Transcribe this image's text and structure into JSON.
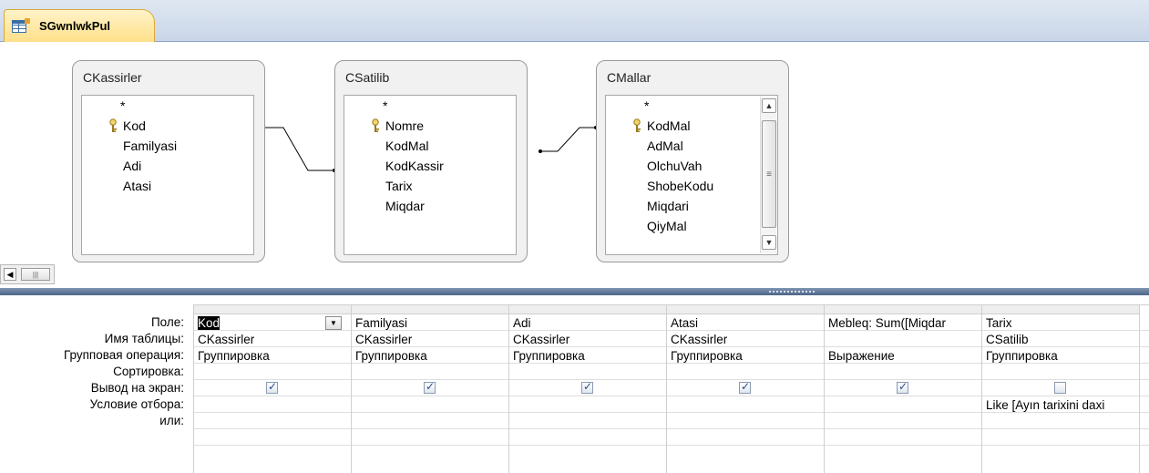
{
  "tab": {
    "title": "SGwnlwkPul",
    "icon": "query-design-icon"
  },
  "tables": [
    {
      "name": "CKassirler",
      "fields": [
        "*",
        "Kod",
        "Familyasi",
        "Adi",
        "Atasi"
      ],
      "key_field": "Kod"
    },
    {
      "name": "CSatilib",
      "fields": [
        "*",
        "Nomre",
        "KodMal",
        "KodKassir",
        "Tarix",
        "Miqdar"
      ],
      "key_field": "Nomre"
    },
    {
      "name": "CMallar",
      "fields": [
        "*",
        "KodMal",
        "AdMal",
        "OlchuVah",
        "ShobeKodu",
        "Miqdari",
        "QiyMal"
      ],
      "key_field": "KodMal"
    }
  ],
  "row_labels": {
    "field": "Поле:",
    "table": "Имя таблицы:",
    "total": "Групповая операция:",
    "sort": "Сортировка:",
    "show": "Вывод на экран:",
    "criteria": "Условие отбора:",
    "or": "или:"
  },
  "columns": [
    {
      "field": "Kod",
      "table": "CKassirler",
      "total": "Группировка",
      "sort": "",
      "show": true,
      "criteria": "",
      "or": ""
    },
    {
      "field": "Familyasi",
      "table": "CKassirler",
      "total": "Группировка",
      "sort": "",
      "show": true,
      "criteria": "",
      "or": ""
    },
    {
      "field": "Adi",
      "table": "CKassirler",
      "total": "Группировка",
      "sort": "",
      "show": true,
      "criteria": "",
      "or": ""
    },
    {
      "field": "Atasi",
      "table": "CKassirler",
      "total": "Группировка",
      "sort": "",
      "show": true,
      "criteria": "",
      "or": ""
    },
    {
      "field": "Mebleq: Sum([Miqdar",
      "table": "",
      "total": "Выражение",
      "sort": "",
      "show": true,
      "criteria": "",
      "or": ""
    },
    {
      "field": "Tarix",
      "table": "CSatilib",
      "total": "Группировка",
      "sort": "",
      "show": false,
      "criteria": "Like [Ayın tarixini daxi",
      "or": ""
    }
  ]
}
